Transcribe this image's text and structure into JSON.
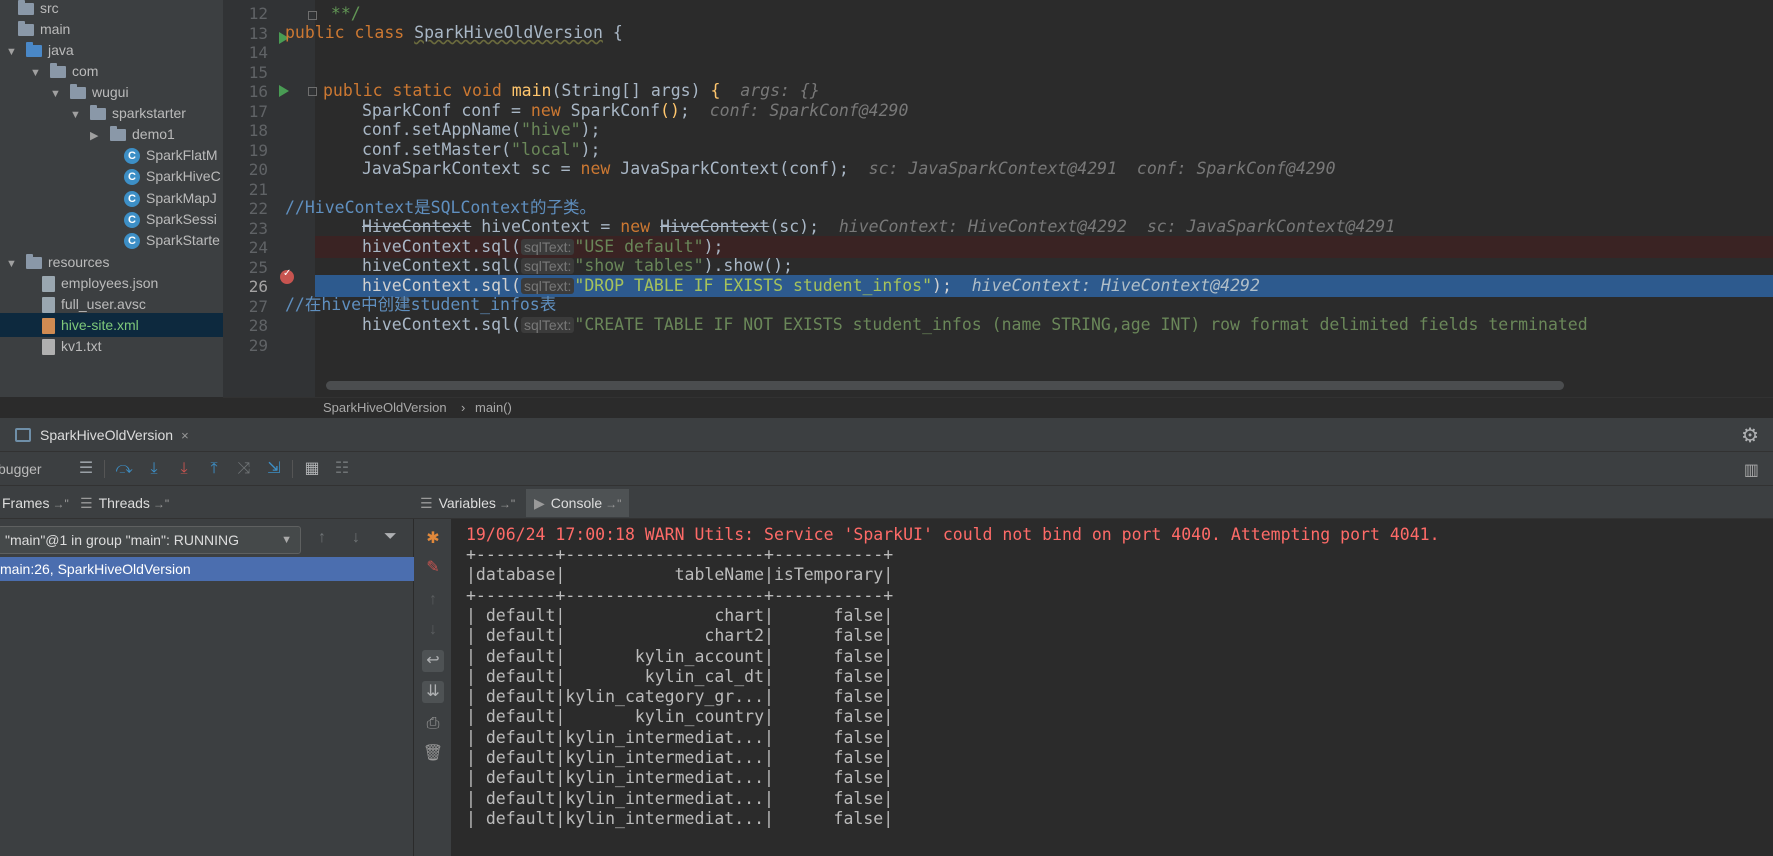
{
  "project_tree": {
    "items": [
      {
        "label": "src",
        "kind": "folder",
        "depth": 0,
        "arrow": ""
      },
      {
        "label": "main",
        "kind": "folder",
        "depth": 0,
        "arrow": ""
      },
      {
        "label": "java",
        "kind": "folder-blue",
        "depth": 0,
        "arrow": "▼"
      },
      {
        "label": "com",
        "kind": "package",
        "depth": 1,
        "arrow": "▼"
      },
      {
        "label": "wugui",
        "kind": "package",
        "depth": 2,
        "arrow": "▼"
      },
      {
        "label": "sparkstarter",
        "kind": "package",
        "depth": 3,
        "arrow": "▼"
      },
      {
        "label": "demo1",
        "kind": "package",
        "depth": 4,
        "arrow": "▶"
      },
      {
        "label": "SparkFlatM",
        "kind": "class",
        "depth": 5,
        "arrow": ""
      },
      {
        "label": "SparkHiveC",
        "kind": "class",
        "depth": 5,
        "arrow": ""
      },
      {
        "label": "SparkMapJ",
        "kind": "class",
        "depth": 5,
        "arrow": ""
      },
      {
        "label": "SparkSessi",
        "kind": "class",
        "depth": 5,
        "arrow": ""
      },
      {
        "label": "SparkStarte",
        "kind": "class",
        "depth": 5,
        "arrow": ""
      },
      {
        "label": "resources",
        "kind": "folder",
        "depth": 0,
        "arrow": "▼"
      },
      {
        "label": "employees.json",
        "kind": "file",
        "depth": 1,
        "arrow": ""
      },
      {
        "label": "full_user.avsc",
        "kind": "file",
        "depth": 1,
        "arrow": ""
      },
      {
        "label": "hive-site.xml",
        "kind": "xml",
        "depth": 1,
        "arrow": "",
        "selected": true
      },
      {
        "label": "kv1.txt",
        "kind": "txt",
        "depth": 1,
        "arrow": ""
      }
    ]
  },
  "editor": {
    "line_numbers": [
      "12",
      "13",
      "14",
      "15",
      "16",
      "17",
      "18",
      "19",
      "20",
      "21",
      "22",
      "23",
      "24",
      "25",
      "26",
      "27",
      "28",
      "29"
    ],
    "current_line": "26",
    "lines": {
      "l12": " **/",
      "l13_kw": "public class ",
      "l13_name": "SparkHiveOldVersion",
      "l13_brace": " {",
      "l16_kw": "public static void ",
      "l16_fn": "main",
      "l16_sig": "(String",
      "l16_arr": "[]",
      "l16_args": " args) ",
      "l16_brace": "{",
      "l16_hint": "args: {}",
      "l17_a": "SparkConf conf = ",
      "l17_new": "new ",
      "l17_b": "SparkConf",
      "l17_c": "();",
      "l17_hint": "conf: SparkConf@4290",
      "l18_a": "conf.setAppName(",
      "l18_s": "\"hive\"",
      "l18_b": ");",
      "l19_a": "conf.setMaster(",
      "l19_s": "\"local\"",
      "l19_b": ");",
      "l20_a": "JavaSparkContext sc = ",
      "l20_new": "new ",
      "l20_b": "JavaSparkContext",
      "l20_c": "(conf);",
      "l20_hint": "sc: JavaSparkContext@4291  conf: SparkConf@4290",
      "l22_comment": "//HiveContext是SQLContext的子类。",
      "l23_type": "HiveContext",
      "l23_a": " hiveContext = ",
      "l23_new": "new ",
      "l23_b": "HiveContext",
      "l23_c": "(sc);",
      "l23_hint": "hiveContext: HiveContext@4292  sc: JavaSparkContext@4291",
      "param_label": "sqlText:",
      "l24_a": "hiveContext.sql(",
      "l24_s": "\"USE default\"",
      "l24_b": ");",
      "l25_a": "hiveContext.sql(",
      "l25_s": "\"show tables\"",
      "l25_b": ").show();",
      "l26_a": "hiveContext.sql(",
      "l26_s": "\"DROP TABLE IF EXISTS student_infos\"",
      "l26_b": ");",
      "l26_hint": "hiveContext: HiveContext@4292",
      "l27_comment": "//在hive中创建student_infos表",
      "l28_a": "hiveContext.sql(",
      "l28_s": "\"CREATE TABLE IF NOT EXISTS student_infos (name STRING,age INT) row format delimited fields terminated"
    }
  },
  "breadcrumb": {
    "class": "SparkHiveOldVersion",
    "sep": "›",
    "method": "main()"
  },
  "debug": {
    "tab_label": "SparkHiveOldVersion",
    "close": "×",
    "toolbar_label": "bugger",
    "frames_tab": "Frames",
    "threads_tab": "Threads",
    "variables_tab": "Variables",
    "console_tab": "Console",
    "pin_glyph": "→\"",
    "thread_select": "\"main\"@1 in group \"main\": RUNNING",
    "frame": "main:26, SparkHiveOldVersion"
  },
  "console": {
    "warn": "19/06/24 17:00:18 WARN Utils: Service 'SparkUI' could not bind on port 4040. Attempting port 4041.",
    "lines": [
      "+--------+--------------------+-----------+",
      "|database|           tableName|isTemporary|",
      "+--------+--------------------+-----------+",
      "| default|               chart|      false|",
      "| default|              chart2|      false|",
      "| default|       kylin_account|      false|",
      "| default|        kylin_cal_dt|      false|",
      "| default|kylin_category_gr...|      false|",
      "| default|       kylin_country|      false|",
      "| default|kylin_intermediat...|      false|",
      "| default|kylin_intermediat...|      false|",
      "| default|kylin_intermediat...|      false|",
      "| default|kylin_intermediat...|      false|",
      "| default|kylin_intermediat...|      false|"
    ]
  },
  "colors": {
    "accent": "#4b6eaf",
    "exec_line": "#2d5a8e",
    "breakpoint": "#c75450",
    "warn": "#ff6b68"
  }
}
